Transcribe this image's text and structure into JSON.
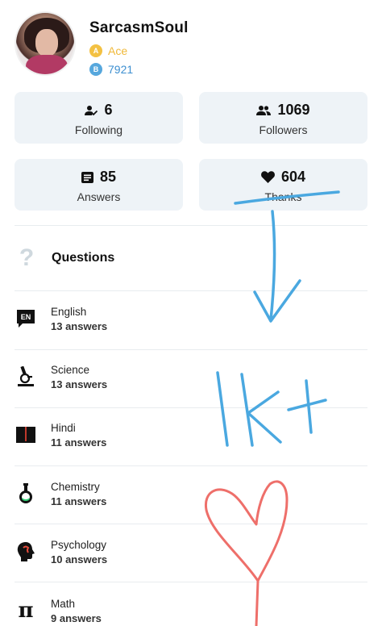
{
  "profile": {
    "username": "SarcasmSoul",
    "rank_label": "Ace",
    "points": "7921",
    "rank_icon": "ace-rank-icon",
    "points_icon": "points-coin-icon",
    "rank_color": "#f0b93a",
    "points_color": "#3d8fd0"
  },
  "stats": {
    "following": {
      "value": "6",
      "label": "Following",
      "icon": "following-icon"
    },
    "followers": {
      "value": "1069",
      "label": "Followers",
      "icon": "followers-icon"
    },
    "answers": {
      "value": "85",
      "label": "Answers",
      "icon": "answers-icon"
    },
    "thanks": {
      "value": "604",
      "label": "Thanks",
      "icon": "heart-icon"
    },
    "card_bg": "#eef3f7"
  },
  "questions": {
    "label": "Questions",
    "icon": "question-mark-icon"
  },
  "subjects": [
    {
      "name": "English",
      "count": "13 answers",
      "icon": "english-icon"
    },
    {
      "name": "Science",
      "count": "13 answers",
      "icon": "microscope-icon"
    },
    {
      "name": "Hindi",
      "count": "11 answers",
      "icon": "book-icon"
    },
    {
      "name": "Chemistry",
      "count": "11 answers",
      "icon": "flask-icon"
    },
    {
      "name": "Psychology",
      "count": "10 answers",
      "icon": "psychology-head-icon"
    },
    {
      "name": "Math",
      "count": "9 answers",
      "icon": "pi-icon"
    }
  ],
  "icon_text": {
    "english_badge": "EN",
    "math_symbol": "π",
    "rank_symbol": "A",
    "points_symbol": "B"
  },
  "annotations": {
    "handwritten_text": "1k+",
    "ink_blue": "#4aa8e0",
    "ink_red": "#ee6f6a"
  }
}
